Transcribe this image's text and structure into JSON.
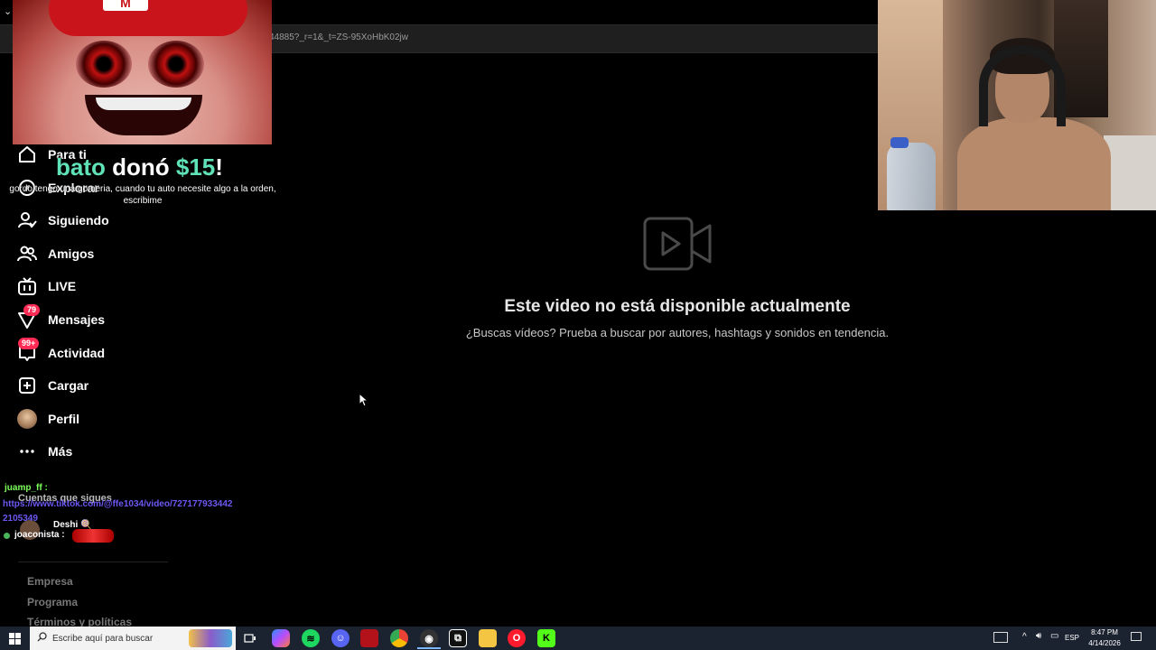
{
  "browser": {
    "url_fragment": "44885?_r=1&_t=ZS-95XoHbK02jw"
  },
  "overlay": {
    "donation": {
      "user": "bato",
      "verb": "donó",
      "amount": "$15",
      "suffix": "!",
      "message": "gordo tengo una gomeria, cuando tu auto necesite algo a la orden, escribime"
    }
  },
  "sidebar": {
    "items": [
      {
        "label": "Para ti",
        "icon": "home-icon"
      },
      {
        "label": "Explorar",
        "icon": "compass-icon"
      },
      {
        "label": "Siguiendo",
        "icon": "following-icon"
      },
      {
        "label": "Amigos",
        "icon": "friends-icon"
      },
      {
        "label": "LIVE",
        "icon": "live-tv-icon"
      },
      {
        "label": "Mensajes",
        "icon": "messages-icon",
        "badge": "79"
      },
      {
        "label": "Actividad",
        "icon": "activity-icon",
        "badge": "99+"
      },
      {
        "label": "Cargar",
        "icon": "upload-plus-icon"
      },
      {
        "label": "Perfil",
        "icon": "avatar"
      },
      {
        "label": "Más",
        "icon": "more-dots-icon"
      }
    ],
    "following_heading": "Cuentas que sigues",
    "following_account": "Deshi 🍭",
    "footer": [
      "Empresa",
      "Programa",
      "Términos y políticas"
    ]
  },
  "chat": {
    "messages": [
      {
        "user": "juamp_ff :",
        "text": "https://www.tiktok.com/@ffe1034/video/7271779334422105349"
      },
      {
        "user": "joaconista :",
        "text": ""
      }
    ]
  },
  "main": {
    "title": "Este video no está disponible actualmente",
    "subtitle": "¿Buscas vídeos? Prueba a buscar por autores, hashtags y sonidos en tendencia."
  },
  "taskbar": {
    "search_placeholder": "Escribe aquí para buscar",
    "language": "ESP",
    "time": "8:47 PM",
    "date": "4/14/2026",
    "apps": [
      "task-view",
      "copilot",
      "spotify",
      "discord",
      "game-app",
      "chrome",
      "obs",
      "capcut",
      "file-explorer",
      "opera",
      "kick"
    ]
  },
  "colors": {
    "accent_badge": "#fe2c55",
    "donation_green": "#5fe2b7",
    "chat_link": "#6b58f2"
  }
}
